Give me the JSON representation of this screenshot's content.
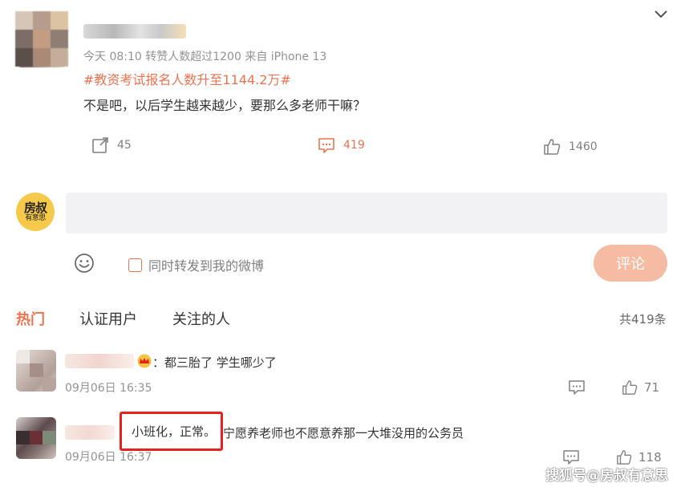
{
  "post": {
    "meta": "今天 08:10 转赞人数超过1200  来自 iPhone 13",
    "hashtag": "#教资考试报名人数升至1144.2万#",
    "text": "不是吧，以后学生越来越少，要那么多老师干嘛？",
    "repost_count": "45",
    "comment_count": "419",
    "like_count": "1460",
    "icons": [
      "share-icon",
      "comment-icon",
      "like-icon",
      "chevron-down-icon"
    ]
  },
  "composer": {
    "avatar_text_big": "房叔",
    "avatar_text_small": "有意思",
    "input_value": "",
    "repost_label": "同时转发到我的微博",
    "submit_label": "评论"
  },
  "tabs": {
    "items": [
      "热门",
      "认证用户",
      "关注的人"
    ],
    "active": "热门",
    "total": "共419条"
  },
  "comments": [
    {
      "text": "：都三胎了 学生哪少了",
      "time": "09月06日 16:35",
      "likes": "71"
    },
    {
      "highlighted_text": "小班化，正常。",
      "text": "宁愿养老师也不愿意养那一大堆没用的公务员",
      "time": "09月06日 16:37",
      "likes": "118"
    }
  ],
  "watermark": "搜狐号@房叔有意思",
  "colors": {
    "accent": "#eb7350",
    "highlight_border": "#e8211f",
    "input_bg": "#f2f2f5",
    "submit_bg": "#f6bba3"
  }
}
